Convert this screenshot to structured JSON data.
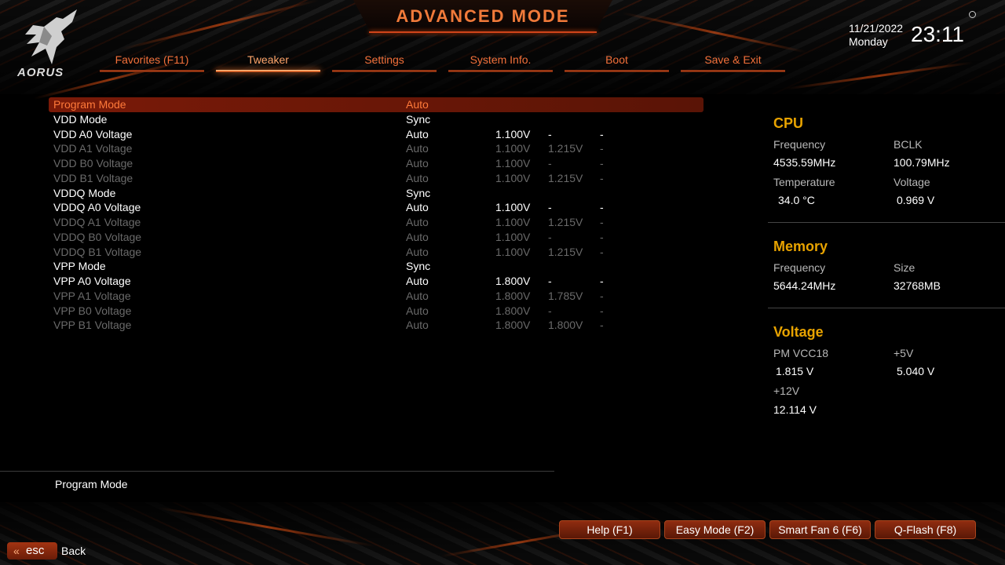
{
  "header": {
    "title": "ADVANCED MODE",
    "brand": "AORUS",
    "date": "11/21/2022",
    "day": "Monday",
    "time": "23:11"
  },
  "tabs": [
    {
      "label": "Favorites (F11)",
      "active": false
    },
    {
      "label": "Tweaker",
      "active": true
    },
    {
      "label": "Settings",
      "active": false
    },
    {
      "label": "System Info.",
      "active": false
    },
    {
      "label": "Boot",
      "active": false
    },
    {
      "label": "Save & Exit",
      "active": false
    }
  ],
  "settings": [
    {
      "label": "Program Mode",
      "value": "Auto",
      "v1": "",
      "v2": "",
      "v3": "",
      "state": "selected"
    },
    {
      "label": "VDD Mode",
      "value": "Sync",
      "v1": "",
      "v2": "",
      "v3": "",
      "state": "normal"
    },
    {
      "label": "VDD A0 Voltage",
      "value": "Auto",
      "v1": "1.100V",
      "v2": "-",
      "v3": "-",
      "state": "normal"
    },
    {
      "label": "VDD A1 Voltage",
      "value": "Auto",
      "v1": "1.100V",
      "v2": "1.215V",
      "v3": "-",
      "state": "dim"
    },
    {
      "label": "VDD B0 Voltage",
      "value": "Auto",
      "v1": "1.100V",
      "v2": "-",
      "v3": "-",
      "state": "dim"
    },
    {
      "label": "VDD B1 Voltage",
      "value": "Auto",
      "v1": "1.100V",
      "v2": "1.215V",
      "v3": "-",
      "state": "dim"
    },
    {
      "label": "VDDQ Mode",
      "value": "Sync",
      "v1": "",
      "v2": "",
      "v3": "",
      "state": "normal"
    },
    {
      "label": "VDDQ A0 Voltage",
      "value": "Auto",
      "v1": "1.100V",
      "v2": "-",
      "v3": "-",
      "state": "normal"
    },
    {
      "label": "VDDQ A1 Voltage",
      "value": "Auto",
      "v1": "1.100V",
      "v2": "1.215V",
      "v3": "-",
      "state": "dim"
    },
    {
      "label": "VDDQ B0 Voltage",
      "value": "Auto",
      "v1": "1.100V",
      "v2": "-",
      "v3": "-",
      "state": "dim"
    },
    {
      "label": "VDDQ B1 Voltage",
      "value": "Auto",
      "v1": "1.100V",
      "v2": "1.215V",
      "v3": "-",
      "state": "dim"
    },
    {
      "label": "VPP Mode",
      "value": "Sync",
      "v1": "",
      "v2": "",
      "v3": "",
      "state": "normal"
    },
    {
      "label": "VPP A0 Voltage",
      "value": "Auto",
      "v1": "1.800V",
      "v2": "-",
      "v3": "-",
      "state": "normal"
    },
    {
      "label": "VPP A1 Voltage",
      "value": "Auto",
      "v1": "1.800V",
      "v2": "1.785V",
      "v3": "-",
      "state": "dim"
    },
    {
      "label": "VPP B0 Voltage",
      "value": "Auto",
      "v1": "1.800V",
      "v2": "-",
      "v3": "-",
      "state": "dim"
    },
    {
      "label": "VPP B1 Voltage",
      "value": "Auto",
      "v1": "1.800V",
      "v2": "1.800V",
      "v3": "-",
      "state": "dim"
    }
  ],
  "cpu": {
    "heading": "CPU",
    "frequency_label": "Frequency",
    "frequency": "4535.59MHz",
    "bclk_label": "BCLK",
    "bclk": "100.79MHz",
    "temperature_label": "Temperature",
    "temperature": "34.0 °C",
    "voltage_label": "Voltage",
    "voltage": "0.969 V"
  },
  "memory": {
    "heading": "Memory",
    "frequency_label": "Frequency",
    "frequency": "5644.24MHz",
    "size_label": "Size",
    "size": "32768MB"
  },
  "voltage": {
    "heading": "Voltage",
    "pmvcc18_label": "PM VCC18",
    "pmvcc18": "1.815 V",
    "p5v_label": "+5V",
    "p5v": "5.040 V",
    "p12v_label": "+12V",
    "p12v": "12.114 V"
  },
  "footer": {
    "help_text": "Program Mode",
    "buttons": [
      "Help (F1)",
      "Easy Mode (F2)",
      "Smart Fan 6 (F6)",
      "Q-Flash (F8)"
    ],
    "esc_label": "esc",
    "back_label": "Back"
  },
  "colors": {
    "accent": "#f2703a",
    "selected_bg": "#7a1a08",
    "heading": "#e8a300",
    "dim_text": "#6a6a6a"
  }
}
